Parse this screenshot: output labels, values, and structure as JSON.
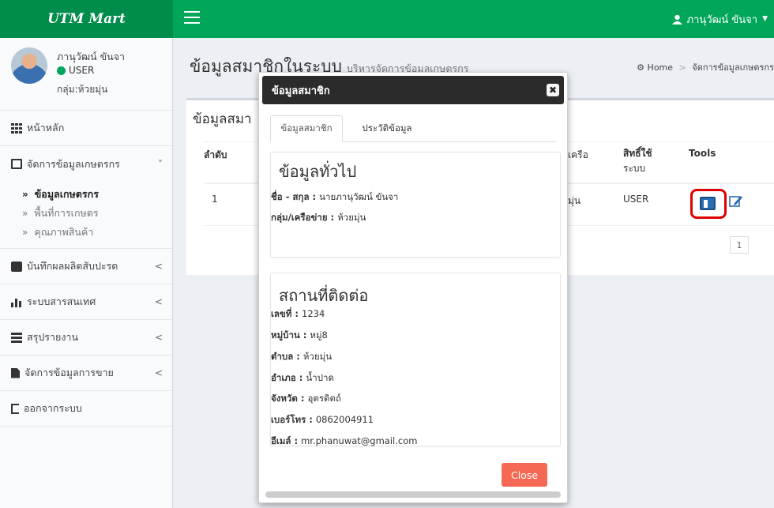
{
  "header": {
    "logo": "UTM Mart",
    "user_menu": "ภานุวัฒน์ ขันจา"
  },
  "sidebar": {
    "user": {
      "name": "ภานุวัฒน์ ขันจา",
      "role": "USER",
      "group": "กลุ่ม:ห้วยมุ่น"
    },
    "items": [
      {
        "label": "หน้าหลัก",
        "icon": "grid-icon"
      },
      {
        "label": "จัดการข้อมูลเกษตรกร",
        "icon": "form-icon",
        "arrow": "˅"
      },
      {
        "label": "บันทึกผลผลิตสับปะรด",
        "icon": "archive-icon",
        "arrow": "<"
      },
      {
        "label": "ระบบสารสนเทศ",
        "icon": "bar-chart-icon",
        "arrow": "<"
      },
      {
        "label": "สรุปรายงาน",
        "icon": "table-icon",
        "arrow": "<"
      },
      {
        "label": "จัดการข้อมูลการขาย",
        "icon": "file-icon",
        "arrow": "<"
      },
      {
        "label": "ออกจากระบบ",
        "icon": "sign-out-icon"
      }
    ],
    "subitems": [
      {
        "label": "ข้อมูลเกษตรกร",
        "active": true
      },
      {
        "label": "พื้นที่การเกษตร",
        "active": false
      },
      {
        "label": "คุณภาพสินค้า",
        "active": false
      }
    ]
  },
  "page": {
    "title": "ข้อมูลสมาชิกในระบบ",
    "subtitle": "บริหารจัดการข้อมูลเกษตรกร",
    "breadcrumb_home": "Home",
    "breadcrumb_current": "จัดการข้อมูลเกษตรกร"
  },
  "box": {
    "title": "ข้อมูลสมา",
    "columns": {
      "order": "ลำดับ",
      "network": "เครือ",
      "rights_1": "สิทธิ์ใช้",
      "rights_2": "ระบบ",
      "tools": "Tools"
    },
    "row": {
      "order": "1",
      "network": "มุ่น",
      "rights": "USER"
    },
    "page_number": "1"
  },
  "modal": {
    "title": "ข้อมูลสมาชิก",
    "close_x": "✖",
    "tabs": [
      "ข้อมูลสมาชิก",
      "ประวัติข้อมูล"
    ],
    "general": {
      "heading": "ข้อมูลทั่วไป",
      "name_label": "ชื่อ - สกุล : ",
      "name_value": "นายภานุวัฒน์ ขันจา",
      "group_label": "กลุ่ม/เครือข่าย : ",
      "group_value": "ห้วยมุ่น"
    },
    "contact": {
      "heading": "สถานที่ติดต่อ",
      "rows": [
        {
          "label": "เลขที่ : ",
          "value": "1234"
        },
        {
          "label": "หมู่บ้าน : ",
          "value": "หมู่8"
        },
        {
          "label": "ตำบล : ",
          "value": "ห้วยมุ่น"
        },
        {
          "label": "อำเภอ : ",
          "value": "น้ำปาด"
        },
        {
          "label": "จังหวัด : ",
          "value": "อุตรดิตถ์"
        },
        {
          "label": "เบอร์โทร : ",
          "value": "0862004911"
        },
        {
          "label": "อีเมล์ : ",
          "value": "mr.phanuwat@gmail.com"
        }
      ]
    },
    "close_button": "Close"
  },
  "colors": {
    "header_green": "#00a65a",
    "logo_green": "#008d4c",
    "close_button": "#f56954",
    "highlight_red": "#e00000"
  }
}
